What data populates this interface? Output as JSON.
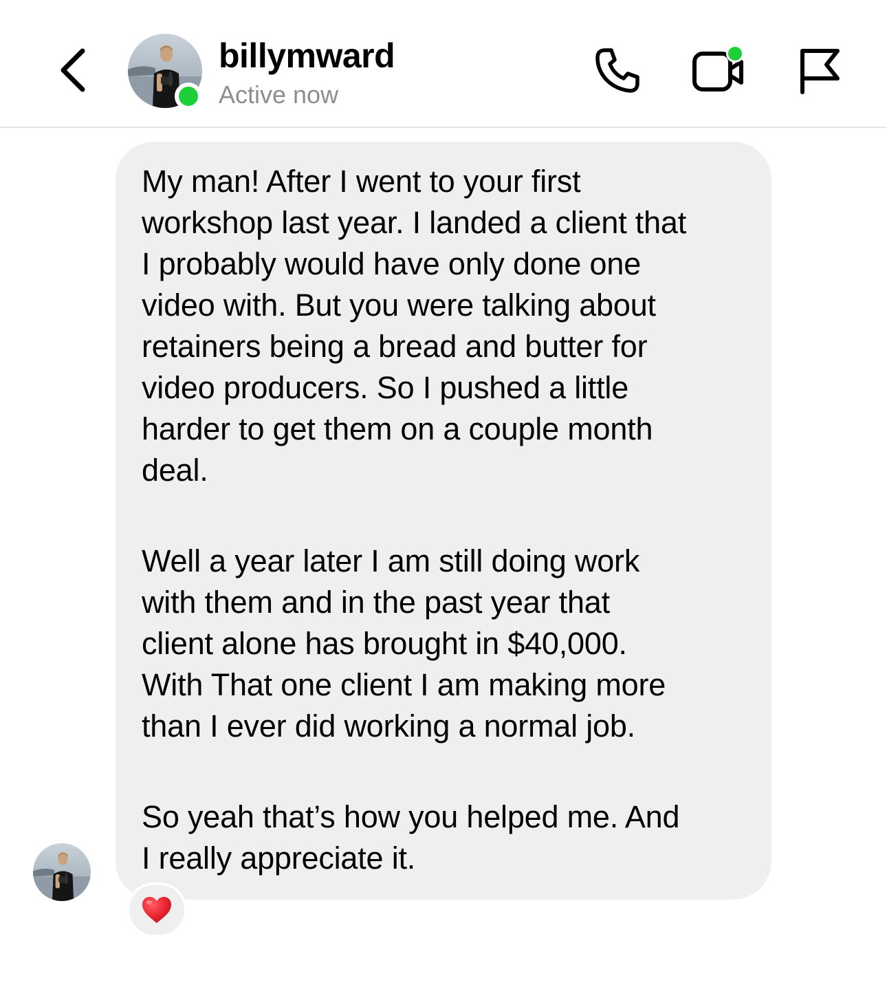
{
  "header": {
    "username": "billymward",
    "status": "Active now",
    "back_icon": "chevron-left-icon",
    "actions": [
      {
        "name": "call",
        "icon": "phone-icon"
      },
      {
        "name": "video-call",
        "icon": "video-camera-icon"
      },
      {
        "name": "report",
        "icon": "flag-icon"
      }
    ]
  },
  "conversation": {
    "message": {
      "paragraphs": [
        "My man! After I went to your first\nworkshop last year. I landed a client that\nI probably would have only done one\nvideo with. But you were talking about\nretainers being a bread and butter for\nvideo producers. So I pushed a little\nharder to get them on a couple month\ndeal.",
        "Well a year later I am still doing work\nwith them and in the past year that\nclient alone has brought in $40,000.\nWith That one client I am making more\nthan I ever did working a normal job.",
        "So yeah that’s how you helped me. And\nI really appreciate it."
      ],
      "reaction": "heart-emoji"
    }
  },
  "colors": {
    "online": "#1fcf3a",
    "bubble": "#efefef",
    "secondary_text": "#8e8e8e",
    "divider": "#e6e6e6",
    "heart": "#e8232f"
  }
}
